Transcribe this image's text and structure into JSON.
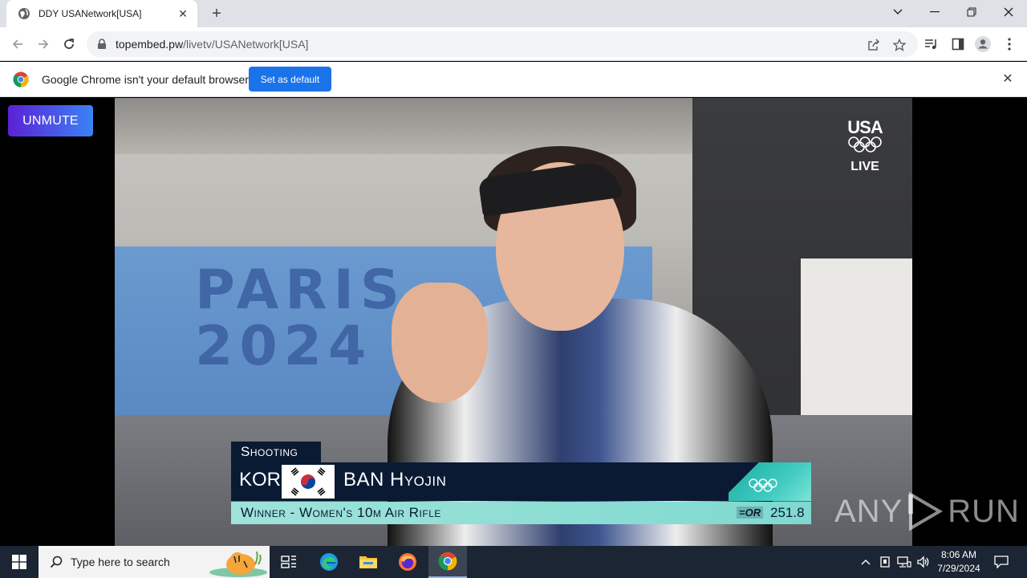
{
  "browser": {
    "tab_title": "DDY USANetwork[USA]",
    "url_host": "topembed.pw",
    "url_path": "/livetv/USANetwork[USA]"
  },
  "infobar": {
    "message": "Google Chrome isn't your default browser",
    "button_label": "Set as default"
  },
  "page": {
    "unmute_label": "UNMUTE",
    "video": {
      "venue_text": "PARIS\n2024",
      "network_logo": "USA",
      "live_label": "LIVE",
      "lower_third": {
        "sport": "Shooting",
        "country": "KOR",
        "athlete": "BAN Hyojin",
        "event": "Winner - Women's 10m Air Rifle",
        "record_badge": "=OR",
        "score": "251.8"
      }
    },
    "watermark": {
      "left": "ANY",
      "right": "RUN"
    }
  },
  "taskbar": {
    "search_placeholder": "Type here to search",
    "time": "8:06 AM",
    "date": "7/29/2024"
  },
  "colors": {
    "unmute_gradient_start": "#5b21d6",
    "unmute_gradient_end": "#3b82f6",
    "set_default_button": "#1a73e8",
    "lower_third_navy": "#0b1a33",
    "lower_third_teal": "#7fd9cf"
  }
}
